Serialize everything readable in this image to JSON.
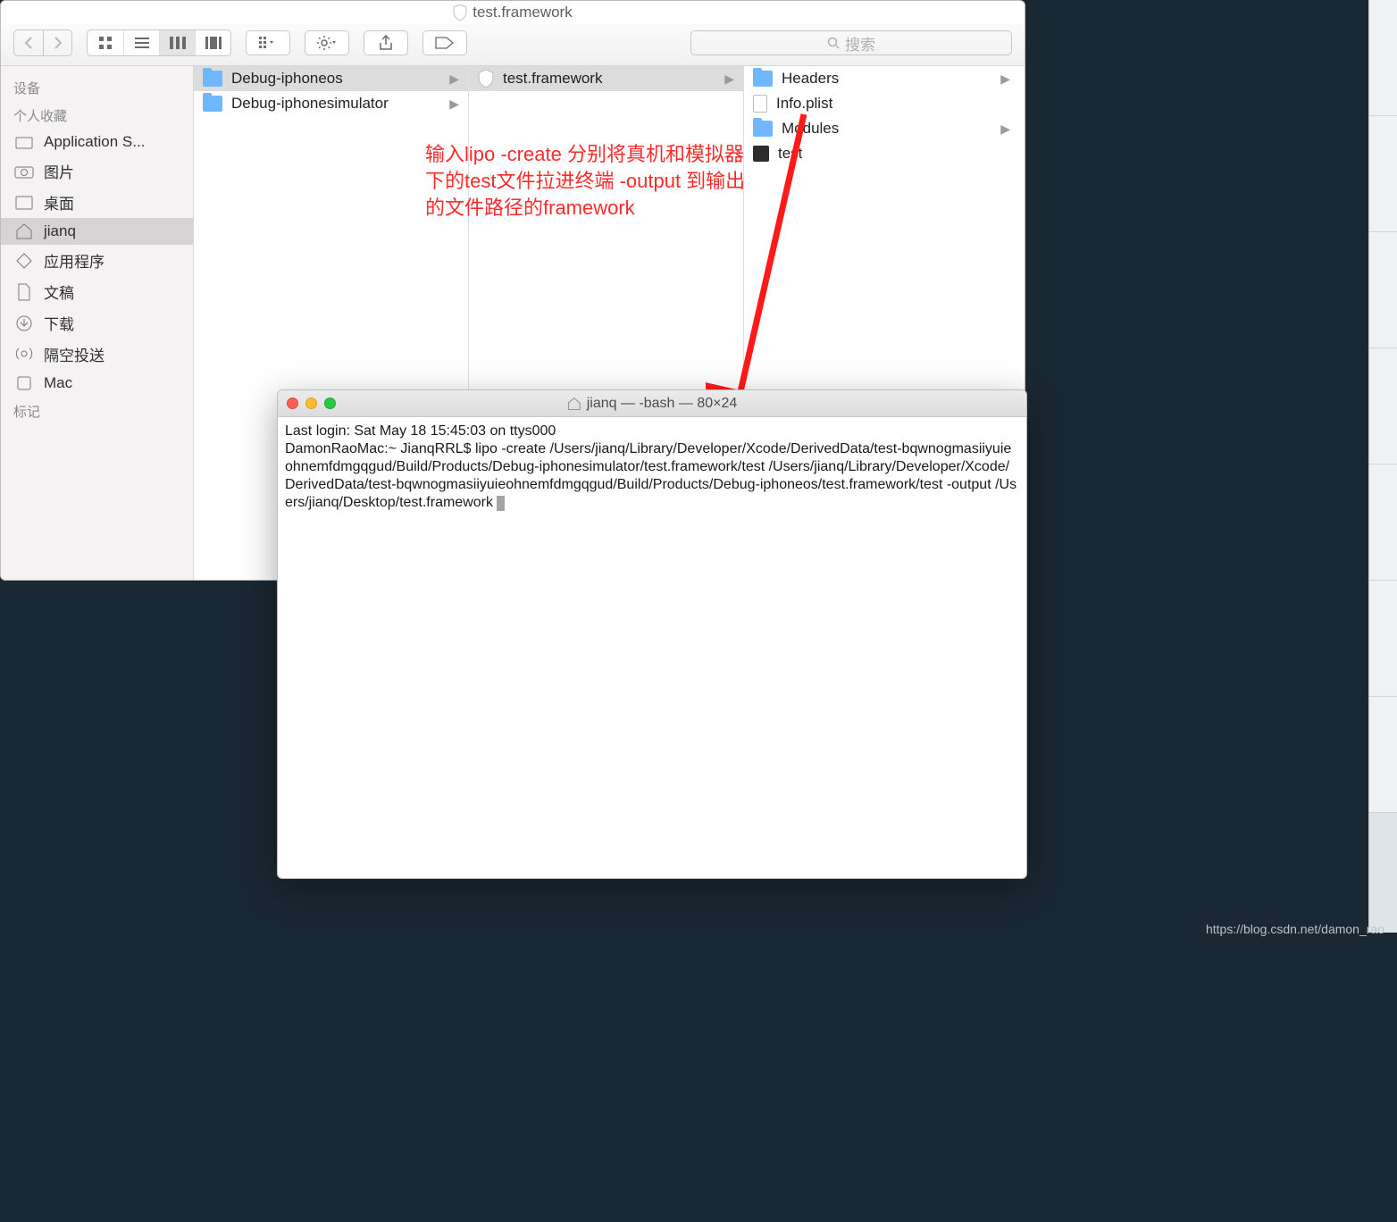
{
  "finder": {
    "title": "test.framework",
    "search_placeholder": "搜索",
    "sidebar": {
      "section_devices": "设备",
      "section_favorites": "个人收藏",
      "section_tags": "标记",
      "items": [
        {
          "label": "Application S..."
        },
        {
          "label": "图片"
        },
        {
          "label": "桌面"
        },
        {
          "label": "jianq"
        },
        {
          "label": "应用程序"
        },
        {
          "label": "文稿"
        },
        {
          "label": "下载"
        },
        {
          "label": "隔空投送"
        },
        {
          "label": "Mac"
        }
      ]
    },
    "col1": [
      {
        "label": "Debug-iphoneos",
        "selected": true,
        "arrow": true
      },
      {
        "label": "Debug-iphonesimulator",
        "arrow": true
      }
    ],
    "col2": [
      {
        "label": "test.framework",
        "selected": true,
        "arrow": true
      }
    ],
    "col3": [
      {
        "label": "Headers",
        "kind": "folder",
        "arrow": true
      },
      {
        "label": "Info.plist",
        "kind": "file"
      },
      {
        "label": "Modules",
        "kind": "folder",
        "arrow": true
      },
      {
        "label": "test",
        "kind": "exec"
      }
    ]
  },
  "annotation": "输入lipo -create 分别将真机和模拟器下的test文件拉进终端 -output 到输出的文件路径的framework",
  "terminal": {
    "title": "jianq — -bash — 80×24",
    "line1": "Last login: Sat May 18 15:45:03 on ttys000",
    "line2": "DamonRaoMac:~ JianqRRL$ lipo -create /Users/jianq/Library/Developer/Xcode/DerivedData/test-bqwnogmasiiyuieohnemfdmgqgud/Build/Products/Debug-iphonesimulator/test.framework/test /Users/jianq/Library/Developer/Xcode/DerivedData/test-bqwnogmasiiyuieohnemfdmgqgud/Build/Products/Debug-iphoneos/test.framework/test -output /Users/jianq/Desktop/test.framework "
  },
  "watermark": "https://blog.csdn.net/damon_rao"
}
